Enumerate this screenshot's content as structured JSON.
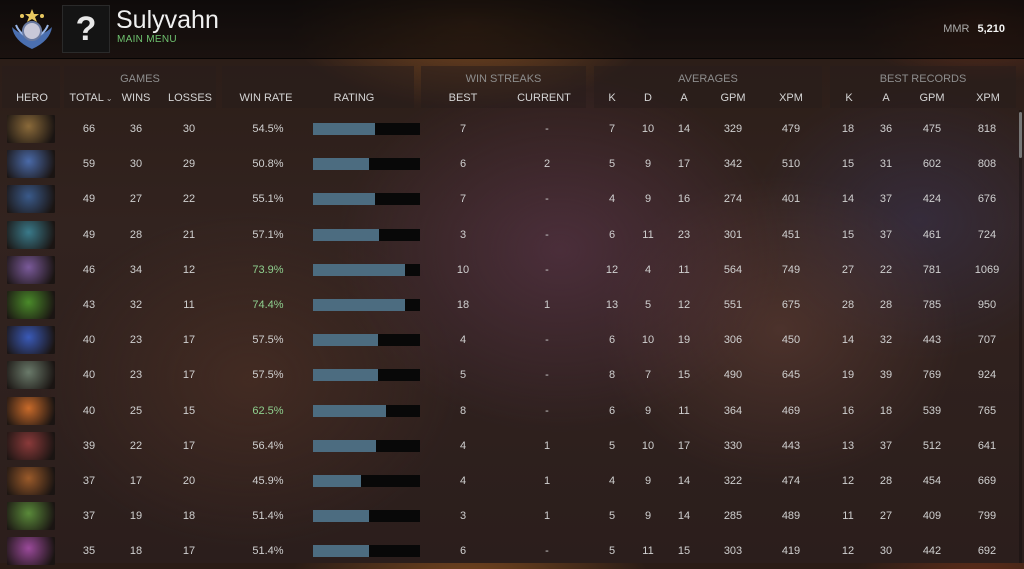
{
  "player": {
    "name": "Sulyvahn",
    "status": "MAIN MENU",
    "mmr_label": "MMR",
    "mmr_value": "5,210",
    "avatar_glyph": "?",
    "medal_icon": "rank-medal-icon"
  },
  "groups": {
    "games": "GAMES",
    "win_streaks": "WIN STREAKS",
    "averages": "AVERAGES",
    "best_records": "BEST RECORDS"
  },
  "columns": {
    "hero": "HERO",
    "total": "TOTAL",
    "total_sort_icon": "⌄",
    "wins": "WINS",
    "losses": "LOSSES",
    "win_rate": "WIN RATE",
    "rating": "RATING",
    "best": "BEST",
    "current": "CURRENT",
    "k": "K",
    "d": "D",
    "a": "A",
    "gpm": "GPM",
    "xpm": "XPM",
    "bk": "K",
    "ba": "A",
    "bgpm": "GPM",
    "bxpm": "XPM"
  },
  "colors": {
    "high_winrate": "#8fd08f",
    "rating_bar": "#4c6c80",
    "status_green": "#6fc26f"
  },
  "rows": [
    {
      "hero_icon": "hero-portrait-icon",
      "hero_color": "#8a6a3a",
      "total": "66",
      "wins": "36",
      "losses": "30",
      "win_rate": "54.5%",
      "rating": 0.58,
      "best": "7",
      "current": "-",
      "k": "7",
      "d": "10",
      "a": "14",
      "gpm": "329",
      "xpm": "479",
      "bk": "18",
      "ba": "36",
      "bgpm": "475",
      "bxpm": "818"
    },
    {
      "hero_icon": "hero-portrait-icon",
      "hero_color": "#4a6aa8",
      "total": "59",
      "wins": "30",
      "losses": "29",
      "win_rate": "50.8%",
      "rating": 0.52,
      "best": "6",
      "current": "2",
      "k": "5",
      "d": "9",
      "a": "17",
      "gpm": "342",
      "xpm": "510",
      "bk": "15",
      "ba": "31",
      "bgpm": "602",
      "bxpm": "808"
    },
    {
      "hero_icon": "hero-portrait-icon",
      "hero_color": "#3a5a8a",
      "total": "49",
      "wins": "27",
      "losses": "22",
      "win_rate": "55.1%",
      "rating": 0.58,
      "best": "7",
      "current": "-",
      "k": "4",
      "d": "9",
      "a": "16",
      "gpm": "274",
      "xpm": "401",
      "bk": "14",
      "ba": "37",
      "bgpm": "424",
      "bxpm": "676"
    },
    {
      "hero_icon": "hero-portrait-icon",
      "hero_color": "#3a7a8a",
      "total": "49",
      "wins": "28",
      "losses": "21",
      "win_rate": "57.1%",
      "rating": 0.62,
      "best": "3",
      "current": "-",
      "k": "6",
      "d": "11",
      "a": "23",
      "gpm": "301",
      "xpm": "451",
      "bk": "15",
      "ba": "37",
      "bgpm": "461",
      "bxpm": "724"
    },
    {
      "hero_icon": "hero-portrait-icon",
      "hero_color": "#7a5a9a",
      "total": "46",
      "wins": "34",
      "losses": "12",
      "win_rate": "73.9%",
      "rating": 0.86,
      "best": "10",
      "current": "-",
      "k": "12",
      "d": "4",
      "a": "11",
      "gpm": "564",
      "xpm": "749",
      "bk": "27",
      "ba": "22",
      "bgpm": "781",
      "bxpm": "1069"
    },
    {
      "hero_icon": "hero-portrait-icon",
      "hero_color": "#4a8a2a",
      "total": "43",
      "wins": "32",
      "losses": "11",
      "win_rate": "74.4%",
      "rating": 0.86,
      "best": "18",
      "current": "1",
      "k": "13",
      "d": "5",
      "a": "12",
      "gpm": "551",
      "xpm": "675",
      "bk": "28",
      "ba": "28",
      "bgpm": "785",
      "bxpm": "950"
    },
    {
      "hero_icon": "hero-portrait-icon",
      "hero_color": "#3a5ab8",
      "total": "40",
      "wins": "23",
      "losses": "17",
      "win_rate": "57.5%",
      "rating": 0.61,
      "best": "4",
      "current": "-",
      "k": "6",
      "d": "10",
      "a": "19",
      "gpm": "306",
      "xpm": "450",
      "bk": "14",
      "ba": "32",
      "bgpm": "443",
      "bxpm": "707"
    },
    {
      "hero_icon": "hero-portrait-icon",
      "hero_color": "#6a7a6a",
      "total": "40",
      "wins": "23",
      "losses": "17",
      "win_rate": "57.5%",
      "rating": 0.61,
      "best": "5",
      "current": "-",
      "k": "8",
      "d": "7",
      "a": "15",
      "gpm": "490",
      "xpm": "645",
      "bk": "19",
      "ba": "39",
      "bgpm": "769",
      "bxpm": "924"
    },
    {
      "hero_icon": "hero-portrait-icon",
      "hero_color": "#c86a2a",
      "total": "40",
      "wins": "25",
      "losses": "15",
      "win_rate": "62.5%",
      "rating": 0.68,
      "best": "8",
      "current": "-",
      "k": "6",
      "d": "9",
      "a": "11",
      "gpm": "364",
      "xpm": "469",
      "bk": "16",
      "ba": "18",
      "bgpm": "539",
      "bxpm": "765"
    },
    {
      "hero_icon": "hero-portrait-icon",
      "hero_color": "#8a3a3a",
      "total": "39",
      "wins": "22",
      "losses": "17",
      "win_rate": "56.4%",
      "rating": 0.59,
      "best": "4",
      "current": "1",
      "k": "5",
      "d": "10",
      "a": "17",
      "gpm": "330",
      "xpm": "443",
      "bk": "13",
      "ba": "37",
      "bgpm": "512",
      "bxpm": "641"
    },
    {
      "hero_icon": "hero-portrait-icon",
      "hero_color": "#9a5a2a",
      "total": "37",
      "wins": "17",
      "losses": "20",
      "win_rate": "45.9%",
      "rating": 0.45,
      "best": "4",
      "current": "1",
      "k": "4",
      "d": "9",
      "a": "14",
      "gpm": "322",
      "xpm": "474",
      "bk": "12",
      "ba": "28",
      "bgpm": "454",
      "bxpm": "669"
    },
    {
      "hero_icon": "hero-portrait-icon",
      "hero_color": "#5a8a3a",
      "total": "37",
      "wins": "19",
      "losses": "18",
      "win_rate": "51.4%",
      "rating": 0.52,
      "best": "3",
      "current": "1",
      "k": "5",
      "d": "9",
      "a": "14",
      "gpm": "285",
      "xpm": "489",
      "bk": "11",
      "ba": "27",
      "bgpm": "409",
      "bxpm": "799"
    },
    {
      "hero_icon": "hero-portrait-icon",
      "hero_color": "#9a4a9a",
      "total": "35",
      "wins": "18",
      "losses": "17",
      "win_rate": "51.4%",
      "rating": 0.52,
      "best": "6",
      "current": "-",
      "k": "5",
      "d": "11",
      "a": "15",
      "gpm": "303",
      "xpm": "419",
      "bk": "12",
      "ba": "30",
      "bgpm": "442",
      "bxpm": "692"
    }
  ]
}
